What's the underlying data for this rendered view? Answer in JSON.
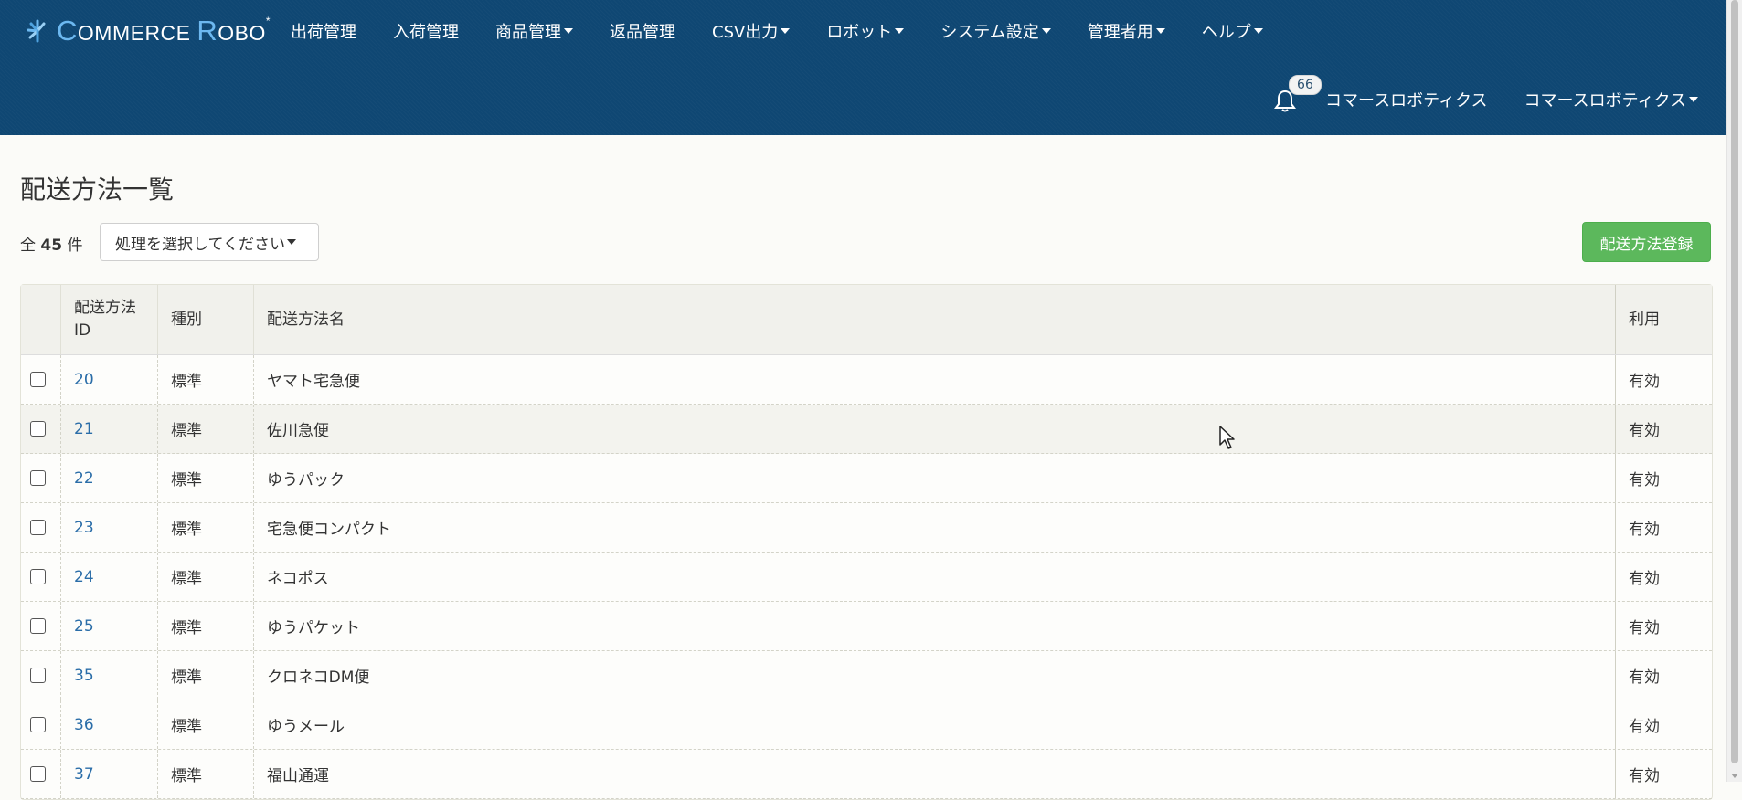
{
  "header": {
    "logo": {
      "part1": "C",
      "part2": "OMMERCE ",
      "part3": "R",
      "part4": "OBO",
      "star": "*"
    },
    "nav": [
      {
        "label": "出荷管理",
        "dropdown": false
      },
      {
        "label": "入荷管理",
        "dropdown": false
      },
      {
        "label": "商品管理",
        "dropdown": true
      },
      {
        "label": "返品管理",
        "dropdown": false
      },
      {
        "label": "CSV出力",
        "dropdown": true
      },
      {
        "label": "ロボット",
        "dropdown": true
      },
      {
        "label": "システム設定",
        "dropdown": true
      },
      {
        "label": "管理者用",
        "dropdown": true
      },
      {
        "label": "ヘルプ",
        "dropdown": true
      }
    ],
    "notifications": "66",
    "company_link": "コマースロボティクス",
    "user_menu": "コマースロボティクス"
  },
  "page": {
    "title": "配送方法一覧",
    "count_prefix": "全",
    "count_value": "45",
    "count_suffix": "件",
    "action_select": "処理を選択してください",
    "register_button": "配送方法登録"
  },
  "table": {
    "headers": {
      "id_line1": "配送方法",
      "id_line2": "ID",
      "type": "種別",
      "name": "配送方法名",
      "use": "利用"
    },
    "rows": [
      {
        "id": "20",
        "type": "標準",
        "name": "ヤマト宅急便",
        "use": "有効"
      },
      {
        "id": "21",
        "type": "標準",
        "name": "佐川急便",
        "use": "有効"
      },
      {
        "id": "22",
        "type": "標準",
        "name": "ゆうパック",
        "use": "有効"
      },
      {
        "id": "23",
        "type": "標準",
        "name": "宅急便コンパクト",
        "use": "有効"
      },
      {
        "id": "24",
        "type": "標準",
        "name": "ネコポス",
        "use": "有効"
      },
      {
        "id": "25",
        "type": "標準",
        "name": "ゆうパケット",
        "use": "有効"
      },
      {
        "id": "35",
        "type": "標準",
        "name": "クロネコDM便",
        "use": "有効"
      },
      {
        "id": "36",
        "type": "標準",
        "name": "ゆうメール",
        "use": "有効"
      },
      {
        "id": "37",
        "type": "標準",
        "name": "福山通運",
        "use": "有効"
      }
    ]
  },
  "colors": {
    "navbar": "#0f4773",
    "link": "#2a6da8",
    "register_button": "#5cb85c",
    "background": "#fbfbf8"
  }
}
